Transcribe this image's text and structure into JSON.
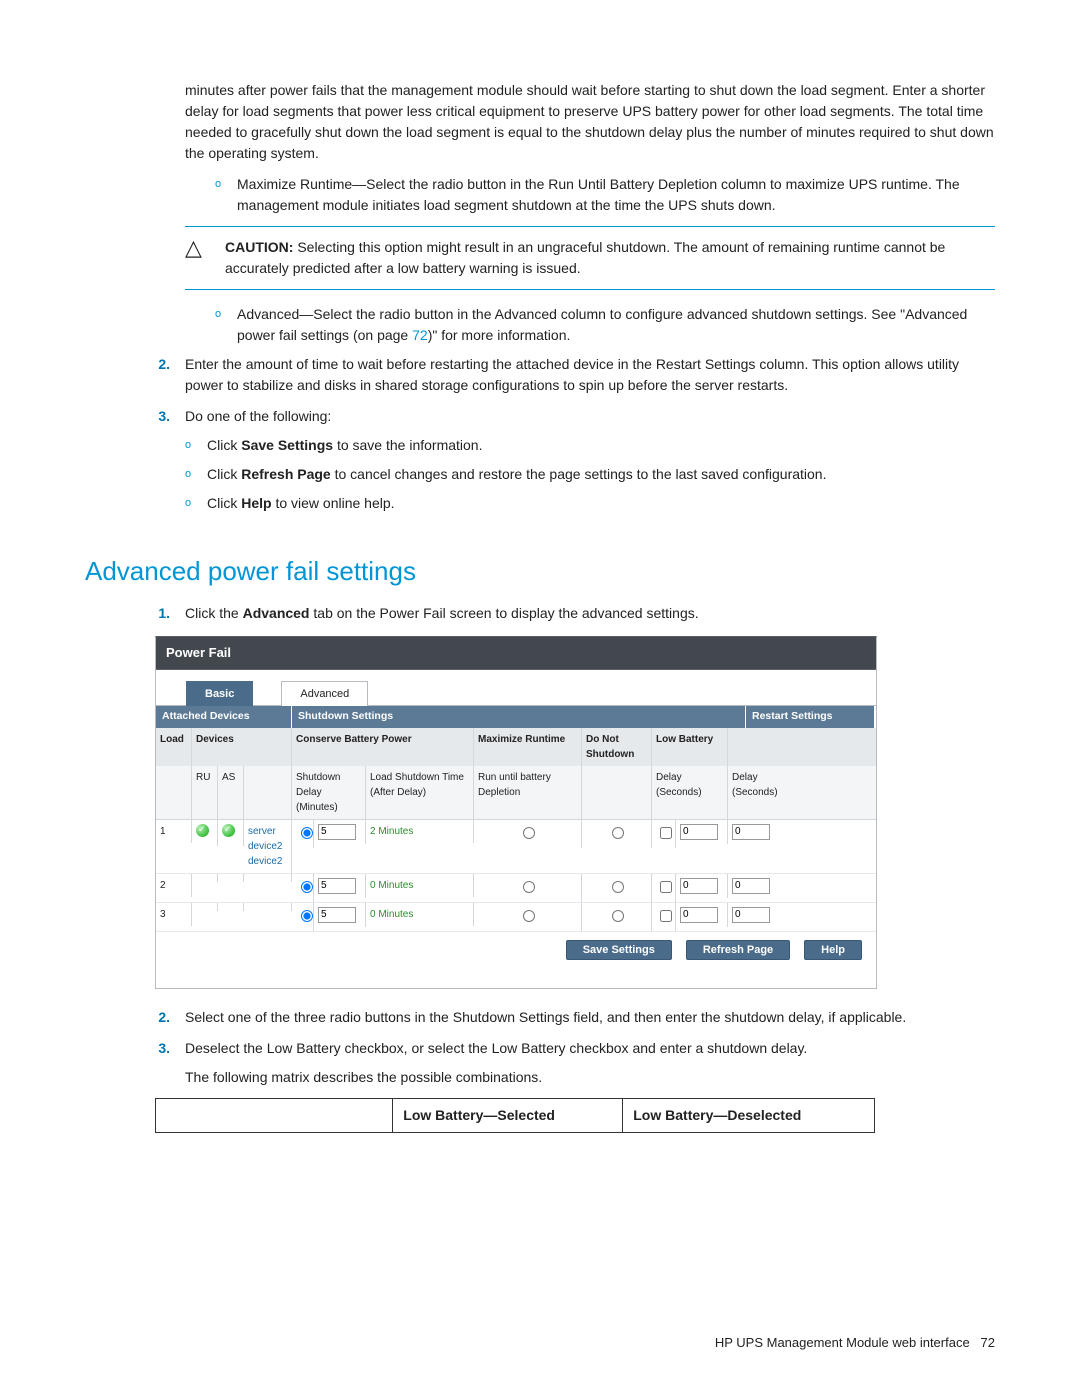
{
  "intro_paragraph": "minutes after power fails that the management module should wait before starting to shut down the load segment. Enter a shorter delay for load segments that power less critical equipment to preserve UPS battery power for other load segments. The total time needed to gracefully shut down the load segment is equal to the shutdown delay plus the number of minutes required to shut down the operating system.",
  "bullet_max_text": "Maximize Runtime—Select the radio button in the Run Until Battery Depletion column to maximize UPS runtime. The management module initiates load segment shutdown at the time the UPS shuts down.",
  "caution_label": "CAUTION:",
  "caution_text": "  Selecting this option might result in an ungraceful shutdown. The amount of remaining runtime cannot be accurately predicted after a low battery warning is issued.",
  "bullet_adv_prefix": "Advanced—Select the radio button in the Advanced column to configure advanced shutdown settings. See \"Advanced power fail settings (on page ",
  "bullet_adv_link": "72",
  "bullet_adv_suffix": ")\" for more information.",
  "step2_text": "Enter the amount of time to wait before restarting the attached device in the Restart Settings column. This option allows utility power to stabilize and disks in shared storage configurations to spin up before the server restarts.",
  "step3_intro": "Do one of the following:",
  "step3_b1_pre": "Click ",
  "step3_b1_bold": "Save Settings",
  "step3_b1_post": " to save the information.",
  "step3_b2_pre": "Click ",
  "step3_b2_bold": "Refresh Page",
  "step3_b2_post": " to cancel changes and restore the page settings to the last saved configuration.",
  "step3_b3_pre": "Click ",
  "step3_b3_bold": "Help",
  "step3_b3_post": " to view online help.",
  "section_heading": "Advanced power fail settings",
  "adv_step1_pre": "Click the ",
  "adv_step1_bold": "Advanced",
  "adv_step1_post": " tab on the Power Fail screen to display the advanced settings.",
  "screenshot": {
    "title": "Power Fail",
    "tab_basic": "Basic",
    "tab_advanced": "Advanced",
    "sec_attached": "Attached Devices",
    "sec_shutdown": "Shutdown Settings",
    "sec_restart": "Restart Settings",
    "sub_load": "Load",
    "sub_devices": "Devices",
    "sub_conserve": "Conserve Battery Power",
    "sub_max": "Maximize Runtime",
    "sub_dns": "Do Not Shutdown",
    "sub_lowbat": "Low Battery",
    "sub_ru": "RU",
    "sub_as": "AS",
    "sub_sd_delay": "Shutdown Delay (Minutes)",
    "sub_lst": "Load Shutdown Time (After Delay)",
    "sub_run_until": "Run until battery Depletion",
    "sub_lb_delay": "Delay (Seconds)",
    "sub_res_delay": "Delay (Seconds)",
    "rows": [
      {
        "load": "1",
        "devices": [
          "server",
          "device2",
          "device2"
        ],
        "sd": "5",
        "lst": "2 Minutes",
        "lb": "0",
        "res": "0",
        "ru": true,
        "as": true
      },
      {
        "load": "2",
        "devices": [],
        "sd": "5",
        "lst": "0 Minutes",
        "lb": "0",
        "res": "0",
        "ru": false,
        "as": false
      },
      {
        "load": "3",
        "devices": [],
        "sd": "5",
        "lst": "0 Minutes",
        "lb": "0",
        "res": "0",
        "ru": false,
        "as": false
      }
    ],
    "btn_save": "Save Settings",
    "btn_refresh": "Refresh Page",
    "btn_help": "Help"
  },
  "adv_step2": "Select one of the three radio buttons in the Shutdown Settings field, and then enter the shutdown delay, if applicable.",
  "adv_step3": "Deselect the Low Battery checkbox, or select the Low Battery checkbox and enter a shutdown delay.",
  "matrix_intro": "The following matrix describes the possible combinations.",
  "matrix_h1": "Low Battery—Selected",
  "matrix_h2": "Low Battery—Deselected",
  "footer_text": "HP UPS Management Module web interface",
  "footer_page": "72"
}
